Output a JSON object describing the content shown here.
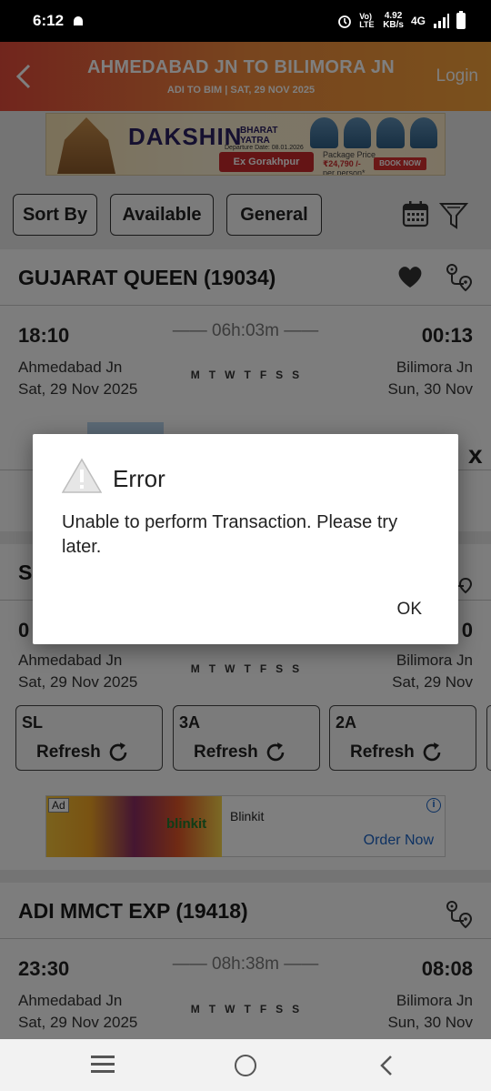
{
  "status_bar": {
    "time": "6:12",
    "lte": "Vo) LTE",
    "speed_value": "4.92",
    "speed_unit": "KB/s",
    "network": "4G"
  },
  "header": {
    "back_icon": "chevron-left",
    "title": "AHMEDABAD JN TO BILIMORA JN",
    "subtitle": "ADI TO BIM | SAT, 29 NOV  2025",
    "login_label": "Login"
  },
  "top_ad": {
    "brand": "DAKSHIN",
    "brand_sub1": "BHARAT",
    "brand_sub2": "YATRA",
    "departure_note": "Departure Date: 08.01.2026",
    "origin": "Ex Gorakhpur",
    "price_label": "Package Price",
    "price": "₹24,790 /-",
    "price_unit": "per person*",
    "cta": "BOOK NOW"
  },
  "filters": {
    "sort_by": "Sort By",
    "available": "Available",
    "general": "General",
    "calendar_icon": "calendar-icon",
    "filter_icon": "funnel-icon"
  },
  "trains": [
    {
      "name": "GUJARAT QUEEN (19034)",
      "dep_time": "18:10",
      "arr_time": "00:13",
      "duration": "06h:03m",
      "from": "Ahmedabad Jn",
      "to": "Bilimora Jn",
      "dep_date": "Sat, 29 Nov  2025",
      "arr_date": "Sun, 30 Nov",
      "days": [
        "M",
        "T",
        "W",
        "T",
        "F",
        "S",
        "S"
      ]
    },
    {
      "name_fragment": "S",
      "dep_time_fragment": "0",
      "arr_time_fragment": "0",
      "from": "Ahmedabad Jn",
      "to": "Bilimora Jn",
      "dep_date": "Sat, 29 Nov  2025",
      "arr_date": "Sat, 29 Nov",
      "days": [
        "M",
        "T",
        "W",
        "T",
        "F",
        "S",
        "S"
      ],
      "classes": [
        {
          "code": "SL",
          "action": "Refresh"
        },
        {
          "code": "3A",
          "action": "Refresh"
        },
        {
          "code": "2A",
          "action": "Refresh"
        }
      ]
    },
    {
      "name": "ADI MMCT EXP (19418)",
      "dep_time": "23:30",
      "arr_time": "08:08",
      "duration": "08h:38m",
      "from": "Ahmedabad Jn",
      "to": "Bilimora Jn",
      "dep_date": "Sat, 29 Nov  2025",
      "arr_date": "Sun, 30 Nov",
      "days": [
        "M",
        "T",
        "W",
        "T",
        "F",
        "S",
        "S"
      ]
    }
  ],
  "bottom_ad": {
    "ad_tag": "Ad",
    "logo": "blinkit",
    "title": "Blinkit",
    "cta": "Order Now",
    "info_icon": "i"
  },
  "dialog": {
    "title": "Error",
    "message": "Unable to perform Transaction. Please try later.",
    "ok_label": "OK"
  },
  "overlay_close": "x"
}
